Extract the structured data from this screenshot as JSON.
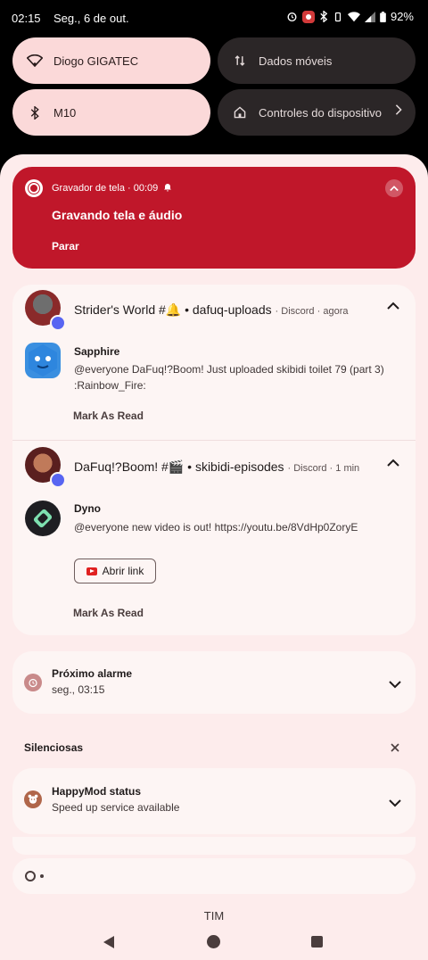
{
  "status_bar": {
    "time": "02:15",
    "date": "Seg., 6 de out.",
    "battery": "92%"
  },
  "quick_tiles": [
    {
      "label": "Diogo GIGATEC",
      "icon": "wifi-icon",
      "active": true
    },
    {
      "label": "Dados móveis",
      "icon": "mobile-data-icon",
      "active": false
    },
    {
      "label": "M10",
      "icon": "bluetooth-icon",
      "active": true
    },
    {
      "label": "Controles do dispositivo",
      "icon": "home-icon",
      "active": false
    }
  ],
  "recorder": {
    "app": "Gravador de tela",
    "elapsed": "00:09",
    "title": "Gravando tela e áudio",
    "stop_label": "Parar"
  },
  "discord": {
    "app": "Discord",
    "conversations": [
      {
        "title": "Strider's World #🔔 • dafuq-uploads",
        "time": "agora",
        "sender": "Sapphire",
        "message": "@everyone DaFuq!?Boom! Just uploaded  skibidi toilet 79 (part 3)  :Rainbow_Fire:",
        "action": "Mark As Read"
      },
      {
        "title": "DaFuq!?Boom! #🎬 • skibidi-episodes",
        "time": "1 min",
        "sender": "Dyno",
        "message": "@everyone new video is out! https://youtu.be/8VdHp0ZoryE",
        "link_button": "Abrir link",
        "action": "Mark As Read"
      }
    ]
  },
  "alarm": {
    "title": "Próximo alarme",
    "time": "seg., 03:15"
  },
  "silent_section": {
    "label": "Silenciosas"
  },
  "happymod": {
    "title": "HappyMod status",
    "text": "Speed up service available"
  },
  "carrier": "TIM",
  "colors": {
    "recorder_bg": "#c0172a",
    "sheet_bg": "#fdecec",
    "tile_active": "#fbd9d9",
    "tile_inactive": "#2b2627",
    "discord_blue": "#5865f2"
  }
}
